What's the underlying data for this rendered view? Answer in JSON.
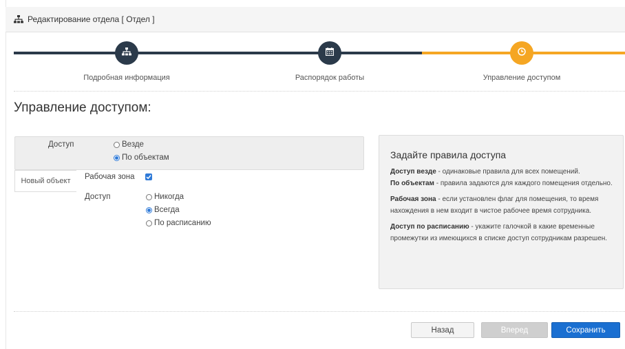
{
  "header": {
    "title": "Редактирование отдела [ Отдел ]",
    "icon": "sitemap-icon"
  },
  "steps": [
    {
      "label": "Подробная информация",
      "icon": "sitemap-icon",
      "state": "done"
    },
    {
      "label": "Распорядок работы",
      "icon": "calendar-icon",
      "state": "done"
    },
    {
      "label": "Управление доступом",
      "icon": "clock-icon",
      "state": "active"
    }
  ],
  "colors": {
    "step_done": "#2b3a4a",
    "step_active": "#f5a623",
    "primary": "#1a6fd1"
  },
  "page_title": "Управление доступом:",
  "access": {
    "label": "Доступ",
    "options": [
      {
        "label": "Везде",
        "selected": false
      },
      {
        "label": "По объектам",
        "selected": true
      }
    ]
  },
  "object": {
    "tab_label": "Новый объект",
    "work_zone_label": "Рабочая зона",
    "work_zone_checked": true,
    "access_label": "Доступ",
    "options": [
      {
        "label": "Никогда",
        "selected": false
      },
      {
        "label": "Всегда",
        "selected": true
      },
      {
        "label": "По расписанию",
        "selected": false
      }
    ]
  },
  "help": {
    "title": "Задайте правила доступа",
    "p1_b1": "Доступ везде",
    "p1_t1": " - одинаковые правила для всех помещений.",
    "p1_b2": "По объектам",
    "p1_t2": " - правила задаются для каждого помещения отдельно.",
    "p2_b": "Рабочая зона",
    "p2_t": " - если установлен флаг для помещения, то время нахождения в нем входит в чистое рабочее время сотрудника.",
    "p3_b": "Доступ по расписанию",
    "p3_t": " - укажите галочкой в какие временные промежутки из имеющихся в списке доступ сотрудникам разрешен."
  },
  "buttons": {
    "back": "Назад",
    "next": "Вперед",
    "save": "Сохранить"
  }
}
